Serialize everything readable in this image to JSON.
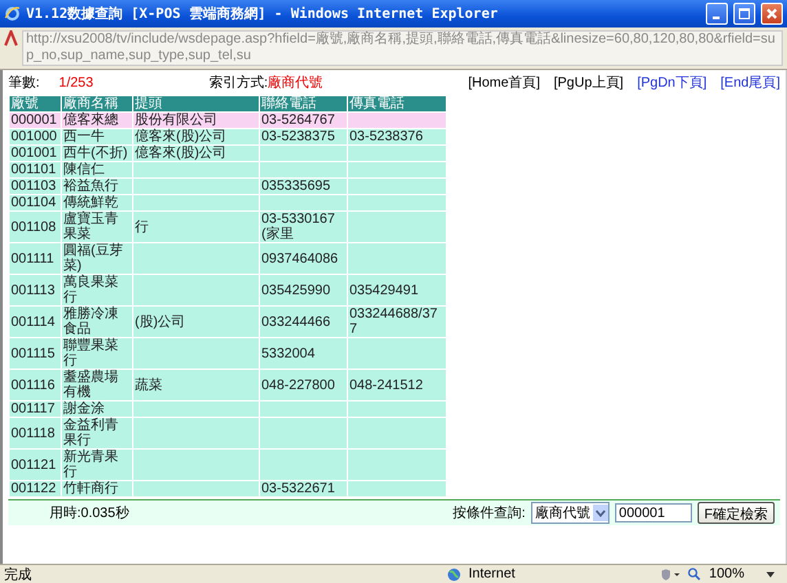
{
  "window": {
    "title": "V1.12数據查詢 [X-POS 雲端商務網] - Windows Internet Explorer"
  },
  "address_bar": {
    "url": "http://xsu2008/tv/include/wsdepage.asp?hfield=廠號,廠商名稱,提頭,聯絡電話,傳真電話&linesize=60,80,120,80,80&rfield=sup_no,sup_name,sup_type,sup_tel,su"
  },
  "info_line": {
    "count_label": "筆數:",
    "count_value": "1/253",
    "index_label": "索引方式:",
    "index_value": "廠商代號",
    "links": [
      {
        "label": "[Home首頁]",
        "enabled": false
      },
      {
        "label": "[PgUp上頁]",
        "enabled": false
      },
      {
        "label": "[PgDn下頁]",
        "enabled": true
      },
      {
        "label": "[End尾頁]",
        "enabled": true
      }
    ]
  },
  "table": {
    "columns": [
      "廠號",
      "廠商名稱",
      "提頭",
      "聯絡電話",
      "傳真電話"
    ],
    "rows": [
      {
        "selected": true,
        "cells": [
          "000001",
          "億客來總",
          "股份有限公司",
          "03-5264767",
          ""
        ]
      },
      {
        "selected": false,
        "cells": [
          "001000",
          "西一牛",
          "億客來(股)公司",
          "03-5238375",
          "03-5238376"
        ]
      },
      {
        "selected": false,
        "cells": [
          "001001",
          "西牛(不折)",
          "億客來(股)公司",
          "",
          ""
        ]
      },
      {
        "selected": false,
        "cells": [
          "001101",
          "陳信仁",
          "",
          "",
          ""
        ]
      },
      {
        "selected": false,
        "cells": [
          "001103",
          "裕益魚行",
          "",
          "035335695",
          ""
        ]
      },
      {
        "selected": false,
        "cells": [
          "001104",
          "傳統鮮乾",
          "",
          "",
          ""
        ]
      },
      {
        "selected": false,
        "cells": [
          "001108",
          "盧寶玉青果菜",
          "行",
          "03-5330167 (家里",
          ""
        ]
      },
      {
        "selected": false,
        "cells": [
          "001111",
          "圓福(豆芽菜)",
          "",
          "0937464086",
          ""
        ]
      },
      {
        "selected": false,
        "cells": [
          "001113",
          "萬良果菜行",
          "",
          "035425990",
          "035429491"
        ]
      },
      {
        "selected": false,
        "cells": [
          "001114",
          "雅勝冷凍食品",
          "(股)公司",
          "033244466",
          "033244688/377"
        ]
      },
      {
        "selected": false,
        "cells": [
          "001115",
          "聯豐果菜行",
          "",
          "5332004",
          ""
        ]
      },
      {
        "selected": false,
        "cells": [
          "001116",
          "耋盛農場有機",
          "蔬菜",
          "048-227800",
          "048-241512"
        ]
      },
      {
        "selected": false,
        "cells": [
          "001117",
          "謝金涂",
          "",
          "",
          ""
        ]
      },
      {
        "selected": false,
        "cells": [
          "001118",
          "金益利青果行",
          "",
          "",
          ""
        ]
      },
      {
        "selected": false,
        "cells": [
          "001121",
          "新光青果行",
          "",
          "",
          ""
        ]
      },
      {
        "selected": false,
        "cells": [
          "001122",
          "竹軒商行",
          "",
          "03-5322671",
          ""
        ]
      }
    ]
  },
  "footer": {
    "elapsed": "用時:0.035秒",
    "search_label": "按條件查詢:",
    "search_field": "廠商代號",
    "search_value": "000001",
    "search_button": "F確定檢索"
  },
  "status_bar": {
    "status": "完成",
    "zone": "Internet",
    "zoom": "100%"
  }
}
